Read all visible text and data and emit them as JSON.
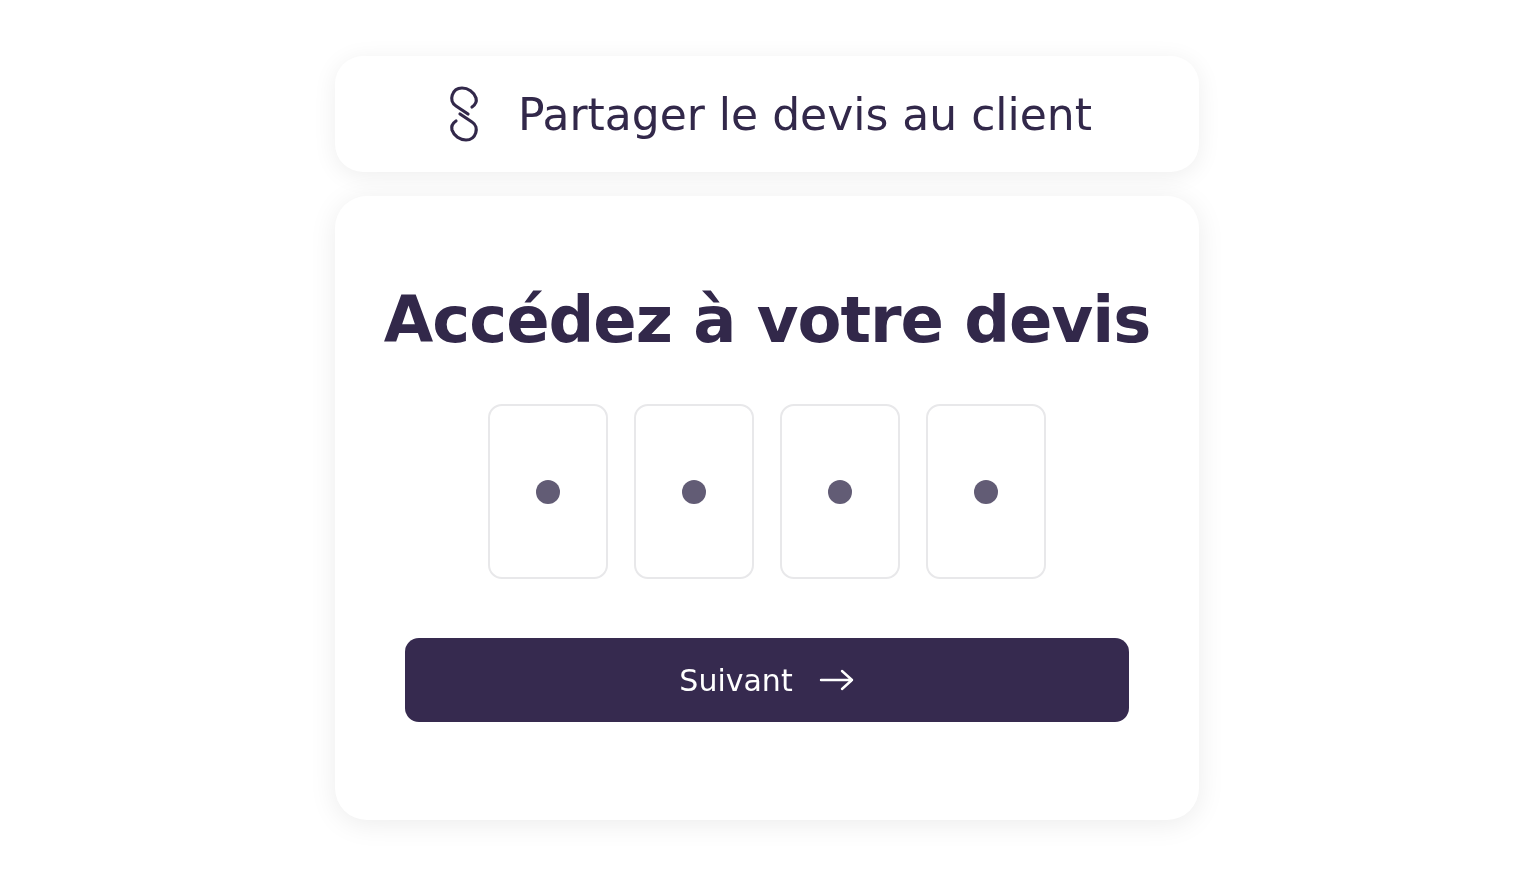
{
  "share_bar": {
    "label": "Partager le devis au client"
  },
  "access_card": {
    "title": "Accédez à votre devis",
    "code_boxes": [
      {
        "filled": true
      },
      {
        "filled": true
      },
      {
        "filled": true
      },
      {
        "filled": true
      }
    ],
    "next_button": {
      "label": "Suivant"
    }
  }
}
